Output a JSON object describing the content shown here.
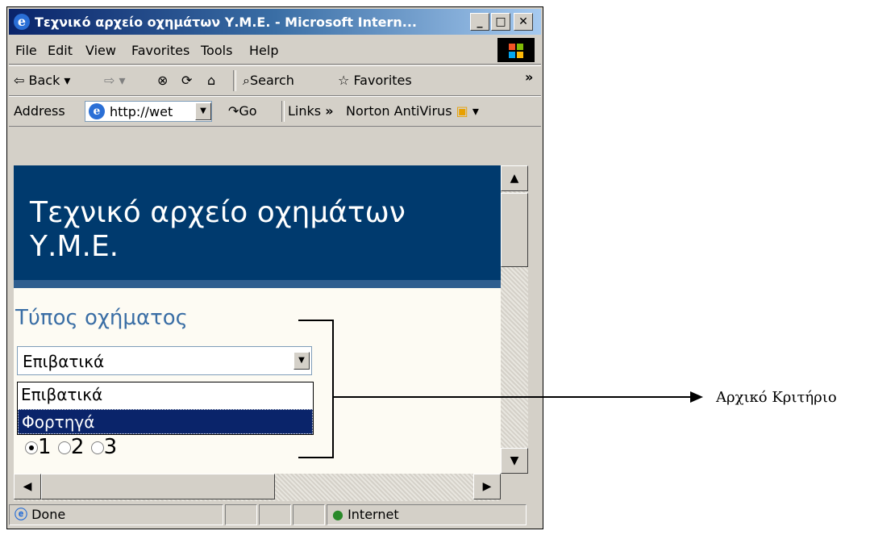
{
  "window": {
    "title": "Τεχνικό αρχείο οχημάτων Υ.Μ.Ε. - Microsoft Intern...",
    "minimize": "_",
    "maximize": "□",
    "close": "✕"
  },
  "menu": [
    "File",
    "Edit",
    "View",
    "Favorites",
    "Tools",
    "Help"
  ],
  "toolbar": {
    "back": "Back",
    "search": "Search",
    "favorites": "Favorites",
    "more": "»"
  },
  "addressbar": {
    "label": "Address",
    "url": "http://wet",
    "go": "Go",
    "links": "Links",
    "links_more": "»",
    "norton": "Norton AntiVirus"
  },
  "page": {
    "banner_title": "Τεχνικό αρχείο οχημάτων Υ.Μ.Ε.",
    "field_label": "Τύπος οχήματος",
    "selected_value": "Επιβατικά",
    "options": [
      "Επιβατικά",
      "Φορτηγά"
    ],
    "radio_labels": [
      "1",
      "2",
      "3"
    ]
  },
  "statusbar": {
    "status": "Done",
    "zone": "Internet"
  },
  "annotation": {
    "text": "Αρχικό Κριτήριο"
  }
}
